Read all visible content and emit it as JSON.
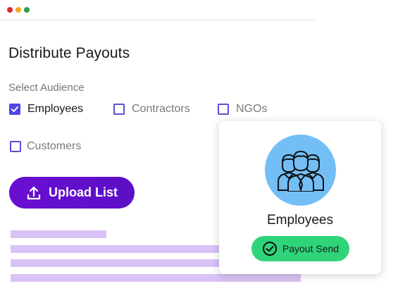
{
  "window": {
    "controls": [
      "close",
      "minimize",
      "maximize"
    ]
  },
  "page": {
    "title": "Distribute Payouts"
  },
  "audience": {
    "label": "Select Audience",
    "options": [
      {
        "label": "Employees",
        "checked": true
      },
      {
        "label": "Contractors",
        "checked": false
      },
      {
        "label": "NGOs",
        "checked": false
      },
      {
        "label": "Customers",
        "checked": false
      }
    ]
  },
  "upload": {
    "label": "Upload List",
    "icon": "upload-icon"
  },
  "card": {
    "title": "Employees",
    "icon": "group-users-icon",
    "status": "Payout Send",
    "status_icon": "check-circle-icon"
  },
  "colors": {
    "accent": "#4f46e5",
    "button": "#6a0fd3",
    "placeholder_bar": "#d9c2f5",
    "avatar_bg": "#73bff5",
    "success": "#2fd47a"
  }
}
